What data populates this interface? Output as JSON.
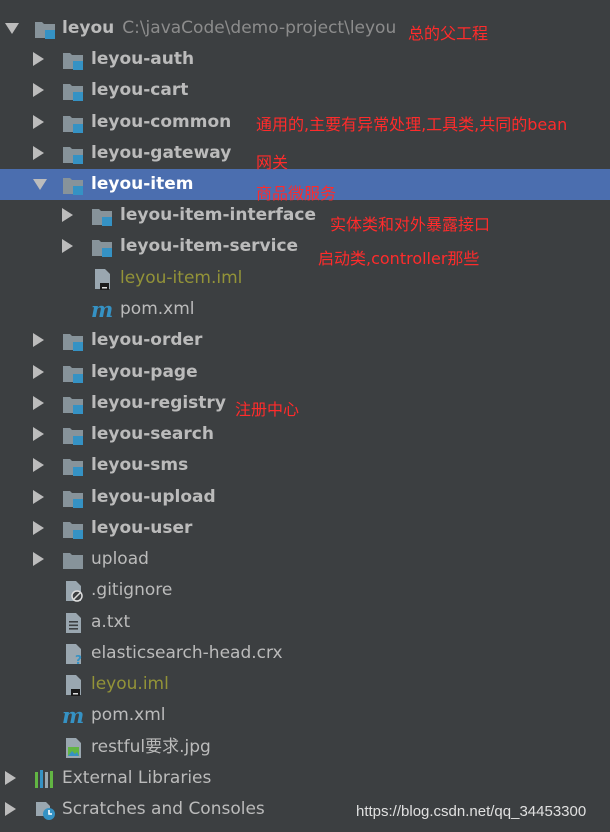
{
  "root": {
    "name": "leyou",
    "path": "C:\\javaCode\\demo-project\\leyou"
  },
  "modules_top": [
    "leyou-auth",
    "leyou-cart",
    "leyou-common",
    "leyou-gateway"
  ],
  "selected_module": "leyou-item",
  "item_children": [
    "leyou-item-interface",
    "leyou-item-service"
  ],
  "item_files": [
    "leyou-item.iml",
    "pom.xml"
  ],
  "modules_bottom": [
    "leyou-order",
    "leyou-page",
    "leyou-registry",
    "leyou-search",
    "leyou-sms",
    "leyou-upload",
    "leyou-user"
  ],
  "folders": [
    "upload"
  ],
  "files": [
    ".gitignore",
    "a.txt",
    "elasticsearch-head.crx",
    "leyou.iml",
    "pom.xml",
    "restful要求.jpg"
  ],
  "extra": [
    "External Libraries",
    "Scratches and Consoles"
  ],
  "annotations": {
    "root": "总的父工程",
    "common": "通用的,主要有异常处理,工具类,共同的bean",
    "gateway": "网关",
    "item": "商品微服务",
    "item_interface": "实体类和对外暴露接口",
    "item_service": "启动类,controller那些",
    "registry": "注册中心"
  },
  "watermark": "https://blog.csdn.net/qq_34453300",
  "colors": {
    "background": "#3c3f41",
    "selection": "#4b6eaf",
    "text": "#bbbbbb",
    "annotation": "#ff2b2b",
    "iml": "#939338",
    "module_badge": "#3592c4"
  }
}
